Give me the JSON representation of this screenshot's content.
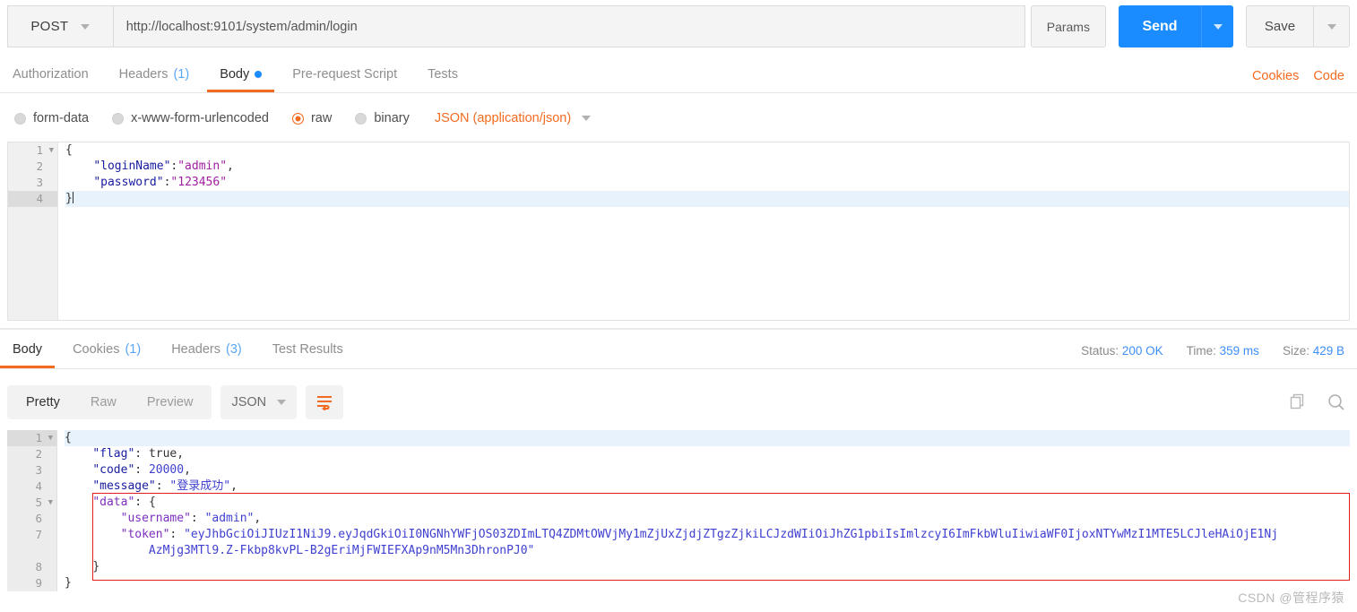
{
  "request": {
    "method": "POST",
    "url": "http://localhost:9101/system/admin/login",
    "params_label": "Params",
    "send_label": "Send",
    "save_label": "Save",
    "tabs": [
      {
        "label": "Authorization",
        "count": "",
        "dot": false,
        "active": false
      },
      {
        "label": "Headers",
        "count": "(1)",
        "dot": false,
        "active": false
      },
      {
        "label": "Body",
        "count": "",
        "dot": true,
        "active": true
      },
      {
        "label": "Pre-request Script",
        "count": "",
        "dot": false,
        "active": false
      },
      {
        "label": "Tests",
        "count": "",
        "dot": false,
        "active": false
      }
    ],
    "cookies_link": "Cookies",
    "code_link": "Code",
    "body_types": [
      {
        "label": "form-data",
        "selected": false
      },
      {
        "label": "x-www-form-urlencoded",
        "selected": false
      },
      {
        "label": "raw",
        "selected": true
      },
      {
        "label": "binary",
        "selected": false
      }
    ],
    "content_type": "JSON (application/json)",
    "body_lines": [
      {
        "num": "1",
        "fold": true,
        "highlight": false
      },
      {
        "num": "2",
        "fold": false,
        "highlight": false
      },
      {
        "num": "3",
        "fold": false,
        "highlight": false
      },
      {
        "num": "4",
        "fold": false,
        "highlight": true
      }
    ],
    "body_code": {
      "l1": "{",
      "l2_key": "\"loginName\"",
      "l2_sep": ":",
      "l2_val": "\"admin\"",
      "l2_end": ",",
      "l3_key": "\"password\"",
      "l3_sep": ":",
      "l3_val": "\"123456\"",
      "l4": "}"
    }
  },
  "response": {
    "tabs": [
      {
        "label": "Body",
        "count": "",
        "active": true
      },
      {
        "label": "Cookies",
        "count": "(1)",
        "active": false
      },
      {
        "label": "Headers",
        "count": "(3)",
        "active": false
      },
      {
        "label": "Test Results",
        "count": "",
        "active": false
      }
    ],
    "meta": {
      "status_key": "Status:",
      "status_val": "200 OK",
      "time_key": "Time:",
      "time_val": "359 ms",
      "size_key": "Size:",
      "size_val": "429 B"
    },
    "view_modes": [
      {
        "label": "Pretty",
        "active": true
      },
      {
        "label": "Raw",
        "active": false
      },
      {
        "label": "Preview",
        "active": false
      }
    ],
    "format": "JSON",
    "lines": [
      {
        "num": "1",
        "fold": true,
        "highlight": true
      },
      {
        "num": "2",
        "fold": false,
        "highlight": false
      },
      {
        "num": "3",
        "fold": false,
        "highlight": false
      },
      {
        "num": "4",
        "fold": false,
        "highlight": false
      },
      {
        "num": "5",
        "fold": true,
        "highlight": false
      },
      {
        "num": "6",
        "fold": false,
        "highlight": false
      },
      {
        "num": "7",
        "fold": false,
        "highlight": false
      },
      {
        "num": "",
        "fold": false,
        "highlight": false
      },
      {
        "num": "8",
        "fold": false,
        "highlight": false
      },
      {
        "num": "9",
        "fold": false,
        "highlight": false
      }
    ],
    "code": {
      "l1": "{",
      "l2_key": "\"flag\"",
      "l2_val": "true",
      "l3_key": "\"code\"",
      "l3_val": "20000",
      "l4_key": "\"message\"",
      "l4_val": "\"登录成功\"",
      "l5_key": "\"data\"",
      "l5_open": "{",
      "l6_key": "\"username\"",
      "l6_val": "\"admin\"",
      "l7_key": "\"token\"",
      "l7_val_a": "\"eyJhbGciOiJIUzI1NiJ9.eyJqdGkiOiI0NGNhYWFjOS03ZDImLTQ4ZDMtOWVjMy1mZjUxZjdjZTgzZjkiLCJzdWIiOiJhZG1pbiIsImlzcyI6ImFkbWluIiwiaWF0IjoxNTYwMzI1MTE5LCJleHAiOjE1Nj",
      "l7_val_b": "AzMjg3MTl9.Z-Fkbp8kvPL-B2gEriMjFWIEFXAp9nM5Mn3DhronPJ0\"",
      "l8": "}",
      "l9": "}"
    }
  },
  "watermark": "CSDN @管程序猿",
  "colors": {
    "accent_orange": "#f26b21",
    "send_blue": "#1a8cff",
    "link_blue": "#3d8ef7",
    "highlight_red": "#e02020"
  }
}
